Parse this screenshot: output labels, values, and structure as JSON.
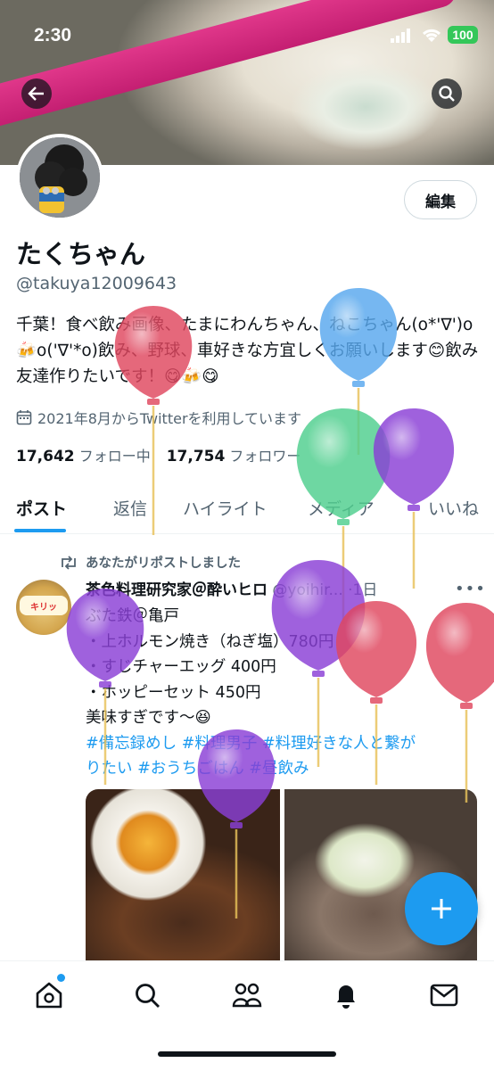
{
  "status_bar": {
    "time": "2:30",
    "battery": "100"
  },
  "profile": {
    "edit_label": "編集",
    "display_name": "たくちゃん",
    "handle": "@takuya12009643",
    "bio": "千葉！食べ飲み画像、たまにわんちゃん、ねこちゃん(o*'∇')o🍻o('∇'*o)飲み、野球、車好きな方宜しくお願いします😊飲み友達作りたいです！😋🍻😋",
    "joined": "2021年8月からTwitterを利用しています",
    "following_count": "17,642",
    "following_label": "フォロー中",
    "followers_count": "17,754",
    "followers_label": "フォロワー"
  },
  "tabs": [
    "ポスト",
    "返信",
    "ハイライト",
    "メディア",
    "いいね"
  ],
  "post": {
    "repost_note": "あなたがリポストしました",
    "author_name": "茶色料理研究家＠酔いヒロ",
    "author_handle": "@yoihir...",
    "time": "·1日",
    "avatar_text": "キリッ",
    "lines": [
      "ぶた鉄＠亀戸",
      "・上ホルモン焼き（ねぎ塩）780円",
      "・すじチャーエッグ 400円",
      "・ホッピーセット 450円",
      "美味すぎです〜😆"
    ],
    "hashtags_line1": "#備忘録めし #料理男子 #料理好きな人と繋が",
    "hashtags_line2": "りたい #おうちごはん #昼飲み"
  },
  "balloons": [
    {
      "color": "#e0475f"
    },
    {
      "color": "#58a8ee"
    },
    {
      "color": "#4fcf8e"
    },
    {
      "color": "#8a3fd6"
    },
    {
      "color": "#8a3fd6"
    },
    {
      "color": "#8a3fd6"
    },
    {
      "color": "#e0475f"
    },
    {
      "color": "#e0475f"
    },
    {
      "color": "#8a3fd6"
    }
  ],
  "bottom_nav": [
    "home-icon",
    "search-icon",
    "communities-icon",
    "notifications-icon",
    "messages-icon"
  ],
  "accent": "#1d9bf0"
}
